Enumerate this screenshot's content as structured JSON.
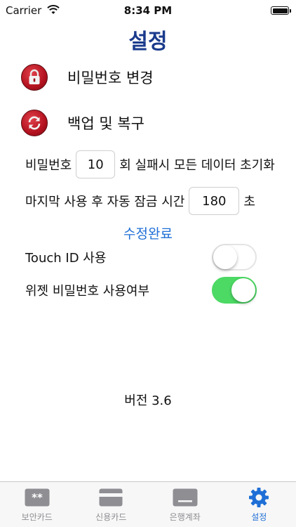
{
  "status_bar": {
    "carrier": "Carrier",
    "time": "8:34 PM"
  },
  "title": "설정",
  "menu": [
    {
      "label": "비밀번호 변경",
      "icon": "lock-icon"
    },
    {
      "label": "백업 및 복구",
      "icon": "sync-icon"
    }
  ],
  "password_reset": {
    "prefix": "비밀번호",
    "value": "10",
    "suffix": "회 실패시 모든 데이터 초기화"
  },
  "auto_lock": {
    "prefix": "마지막 사용 후 자동 잠금 시간",
    "value": "180",
    "suffix": "초"
  },
  "done_label": "수정완료",
  "toggles": [
    {
      "label": "Touch ID 사용",
      "on": false
    },
    {
      "label": "위젯 비밀번호 사용여부",
      "on": true
    }
  ],
  "version": "버전 3.6",
  "tabs": [
    {
      "label": "보안카드",
      "icon": "security-card-icon",
      "active": false
    },
    {
      "label": "신용카드",
      "icon": "credit-card-icon",
      "active": false
    },
    {
      "label": "은행계좌",
      "icon": "bank-account-icon",
      "active": false
    },
    {
      "label": "설정",
      "icon": "gear-icon",
      "active": true
    }
  ],
  "colors": {
    "title": "#1a3a8c",
    "accent": "#1f6fd6",
    "switch_on": "#4cd964",
    "icon_red": "#b3121f"
  }
}
